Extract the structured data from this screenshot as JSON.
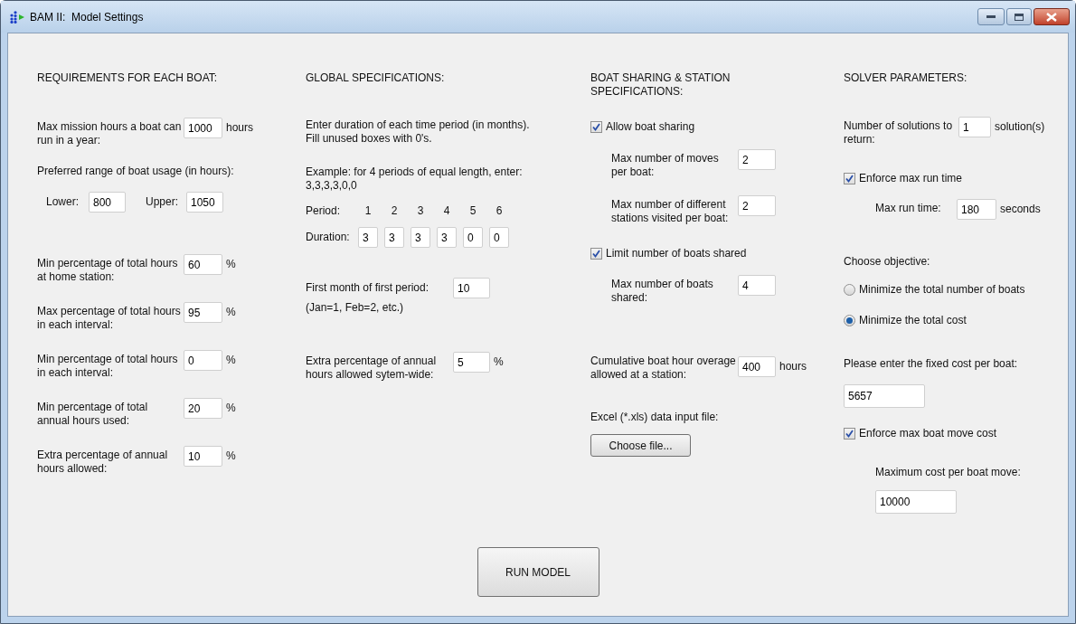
{
  "window": {
    "title": "BAM II:  Model Settings"
  },
  "sections": [
    {
      "title": "REQUIREMENTS FOR EACH BOAT:",
      "rows": [
        {
          "kind": "field",
          "label": "Max mission hours a boat can run in a year:",
          "value": "1000",
          "unit": "hours"
        },
        {
          "kind": "text",
          "text": "Preferred range of boat usage (in hours):"
        },
        {
          "kind": "range",
          "fields": [
            {
              "label": "Lower:",
              "value": "800"
            },
            {
              "label": "Upper:",
              "value": "1050"
            }
          ]
        },
        {
          "kind": "field",
          "label": "Min percentage of total hours at home station:",
          "value": "60",
          "unit": "%"
        },
        {
          "kind": "field",
          "label": "Max percentage of total hours in each interval:",
          "value": "95",
          "unit": "%"
        },
        {
          "kind": "field",
          "label": "Min percentage of total hours in each interval:",
          "value": "0",
          "unit": "%"
        },
        {
          "kind": "field",
          "label": "Min percentage of total annual hours used:",
          "value": "20",
          "unit": "%"
        },
        {
          "kind": "field",
          "label": "Extra percentage of annual hours allowed:",
          "value": "10",
          "unit": "%"
        }
      ]
    },
    {
      "title": "GLOBAL SPECIFICATIONS:",
      "rows": [
        {
          "kind": "text",
          "text": "Enter duration of each time period (in months).\nFill unused boxes with 0's."
        },
        {
          "kind": "text",
          "text": "Example: for 4 periods of equal length, enter:\n3,3,3,3,0,0"
        },
        {
          "kind": "periods",
          "period_label": "Period:",
          "periods": [
            "1",
            "2",
            "3",
            "4",
            "5",
            "6"
          ],
          "duration_label": "Duration:",
          "durations": [
            "3",
            "3",
            "3",
            "3",
            "0",
            "0"
          ]
        },
        {
          "kind": "field",
          "label": "First month of first period:",
          "note": "(Jan=1, Feb=2, etc.)",
          "value": "10"
        },
        {
          "kind": "field",
          "label": "Extra percentage of annual hours allowed sytem-wide:",
          "value": "5",
          "unit": "%"
        }
      ]
    },
    {
      "title": "BOAT SHARING & STATION SPECIFICATIONS:",
      "rows": [
        {
          "kind": "checkbox",
          "label": "Allow boat sharing",
          "checked": true,
          "children": [
            {
              "kind": "field",
              "label": "Max number of moves per boat:",
              "value": "2"
            },
            {
              "kind": "field",
              "label": "Max number of different stations visited per boat:",
              "value": "2"
            }
          ]
        },
        {
          "kind": "checkbox",
          "label": "Limit number of boats shared",
          "checked": true,
          "children": [
            {
              "kind": "field",
              "label": "Max number of boats shared:",
              "value": "4"
            }
          ]
        },
        {
          "kind": "field",
          "label": "Cumulative boat hour overage allowed at a station:",
          "value": "400",
          "unit": "hours"
        },
        {
          "kind": "text",
          "text": "Excel (*.xls) data input file:"
        },
        {
          "kind": "button",
          "label": "Choose file..."
        }
      ]
    },
    {
      "title": "SOLVER PARAMETERS:",
      "rows": [
        {
          "kind": "field",
          "label": "Number of solutions to return:",
          "value": "1",
          "unit": "solution(s)"
        },
        {
          "kind": "checkbox",
          "label": "Enforce max run time",
          "checked": true,
          "children": [
            {
              "kind": "field",
              "label": "Max run time:",
              "value": "180",
              "unit": "seconds"
            }
          ]
        },
        {
          "kind": "text",
          "text": "Choose objective:"
        },
        {
          "kind": "radio",
          "label": "Minimize the total number of boats",
          "selected": false
        },
        {
          "kind": "radio",
          "label": "Minimize the total cost",
          "selected": true
        },
        {
          "kind": "text",
          "text": "Please enter the fixed cost per boat:"
        },
        {
          "kind": "input",
          "value": "5657"
        },
        {
          "kind": "checkbox",
          "label": "Enforce max boat move cost",
          "checked": true,
          "children": [
            {
              "kind": "text",
              "text": "Maximum cost per boat move:"
            },
            {
              "kind": "input",
              "value": "10000"
            }
          ]
        }
      ]
    }
  ],
  "run_button": "RUN MODEL"
}
